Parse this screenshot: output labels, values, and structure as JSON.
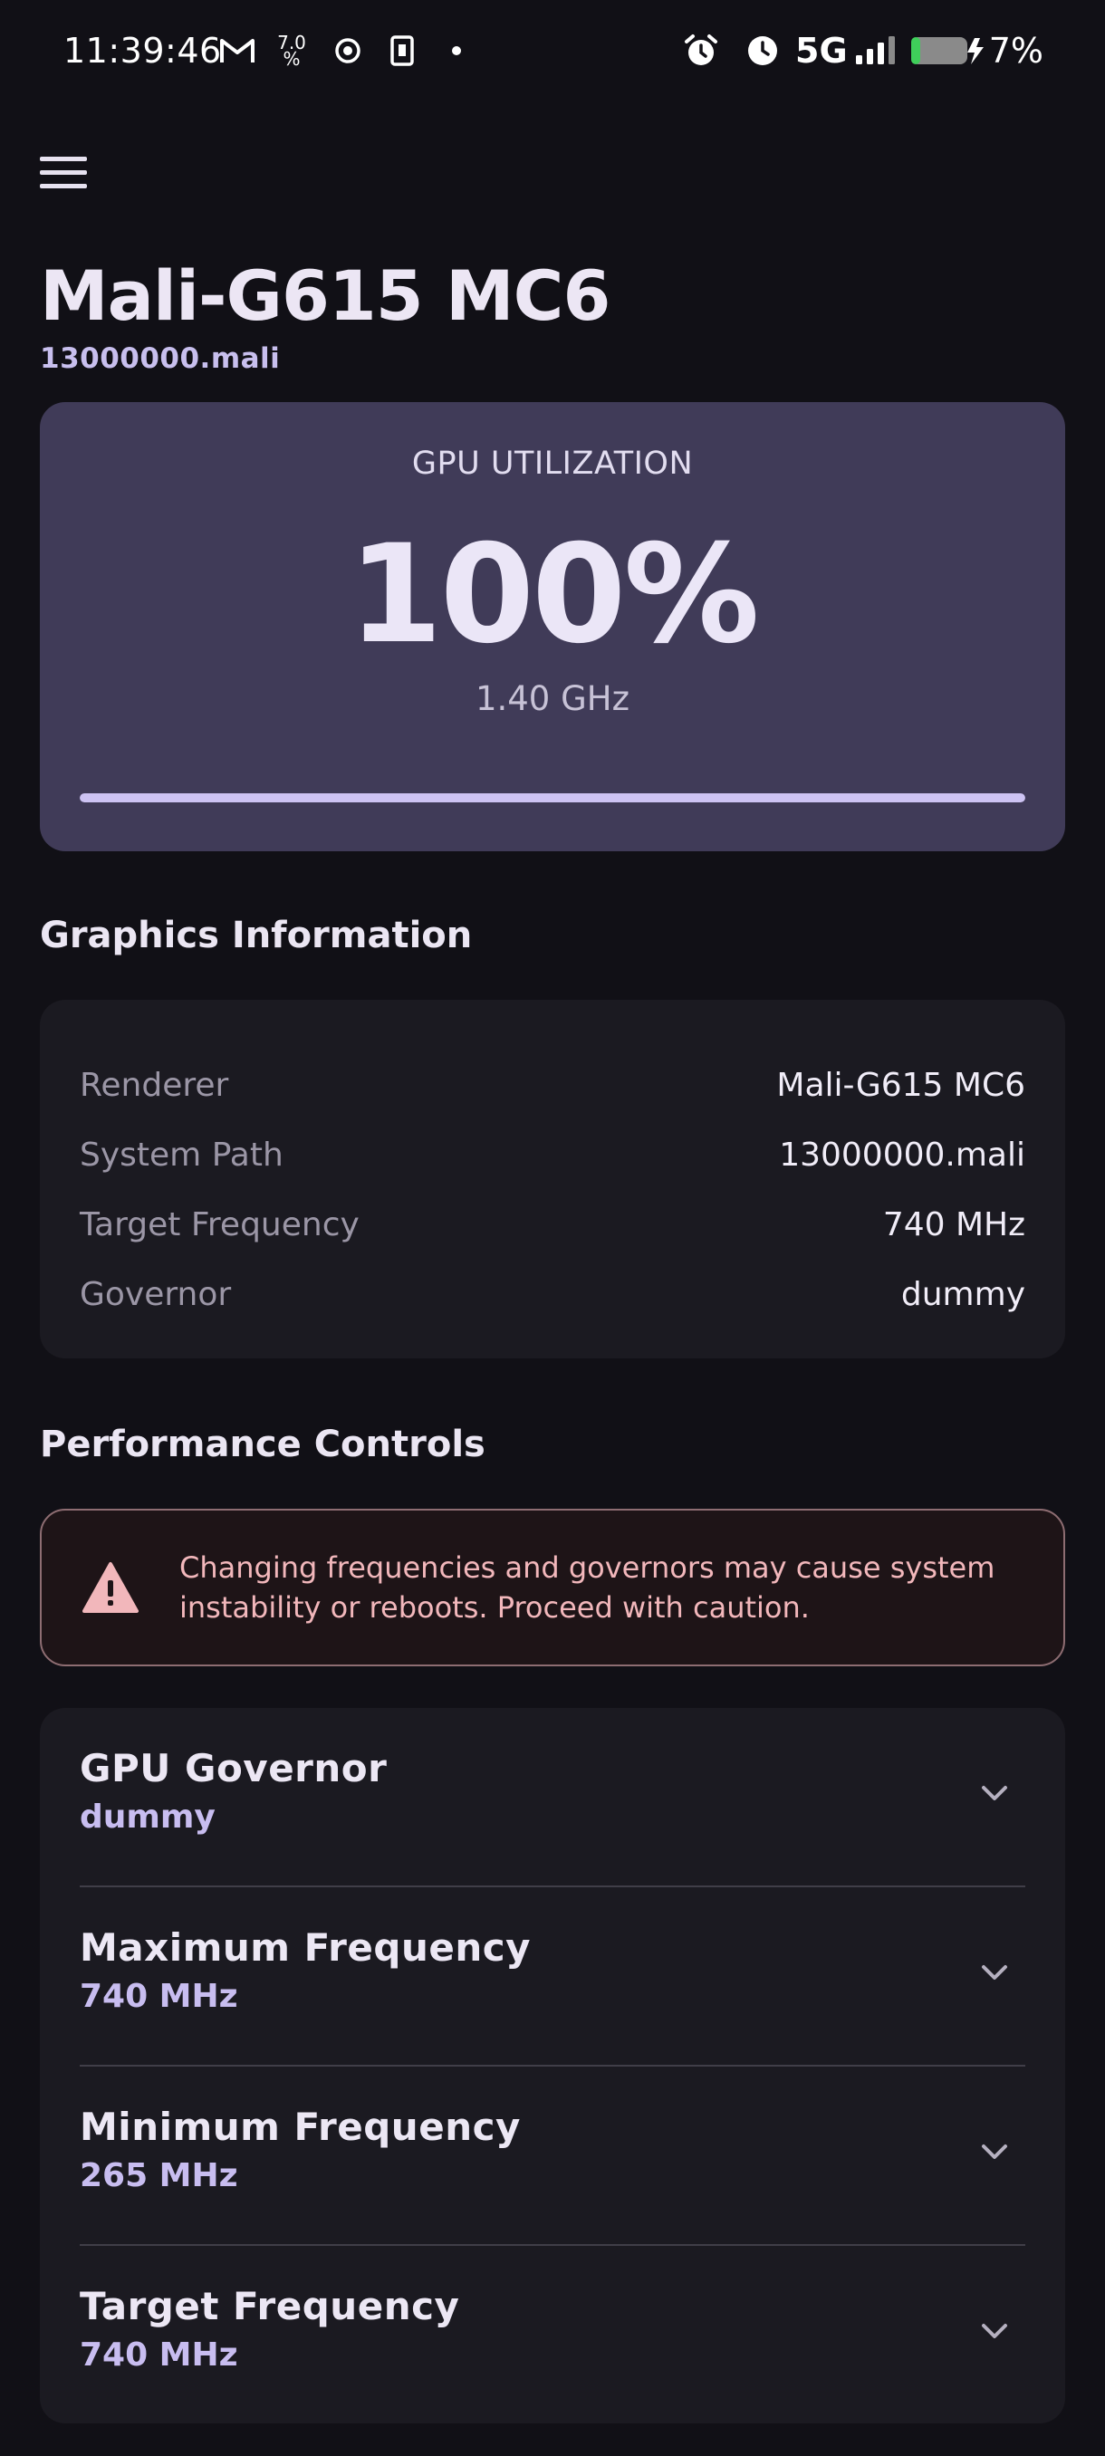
{
  "status_bar": {
    "time": "11:39:46",
    "net_speed_top": "7.0",
    "net_speed_bottom": "%",
    "network": "5G",
    "battery": "7%"
  },
  "header": {
    "title": "Mali-G615 MC6",
    "subtitle": "13000000.mali"
  },
  "utilization": {
    "label": "GPU UTILIZATION",
    "value": "100%",
    "percent": 100,
    "frequency": "1.40 GHz"
  },
  "graphics_info": {
    "section_title": "Graphics Information",
    "rows": [
      {
        "key": "Renderer",
        "value": "Mali-G615 MC6"
      },
      {
        "key": "System Path",
        "value": "13000000.mali"
      },
      {
        "key": "Target Frequency",
        "value": "740 MHz"
      },
      {
        "key": "Governor",
        "value": "dummy"
      }
    ]
  },
  "performance": {
    "section_title": "Performance Controls",
    "warning": "Changing frequencies and governors may cause system instability or reboots. Proceed with caution.",
    "controls": [
      {
        "label": "GPU Governor",
        "value": "dummy"
      },
      {
        "label": "Maximum Frequency",
        "value": "740 MHz"
      },
      {
        "label": "Minimum Frequency",
        "value": "265 MHz"
      },
      {
        "label": "Target Frequency",
        "value": "740 MHz"
      }
    ]
  },
  "colors": {
    "background": "#111016",
    "accent": "#c8bdf0",
    "util_card": "#403b58",
    "warning_text": "#f2b7bb"
  }
}
